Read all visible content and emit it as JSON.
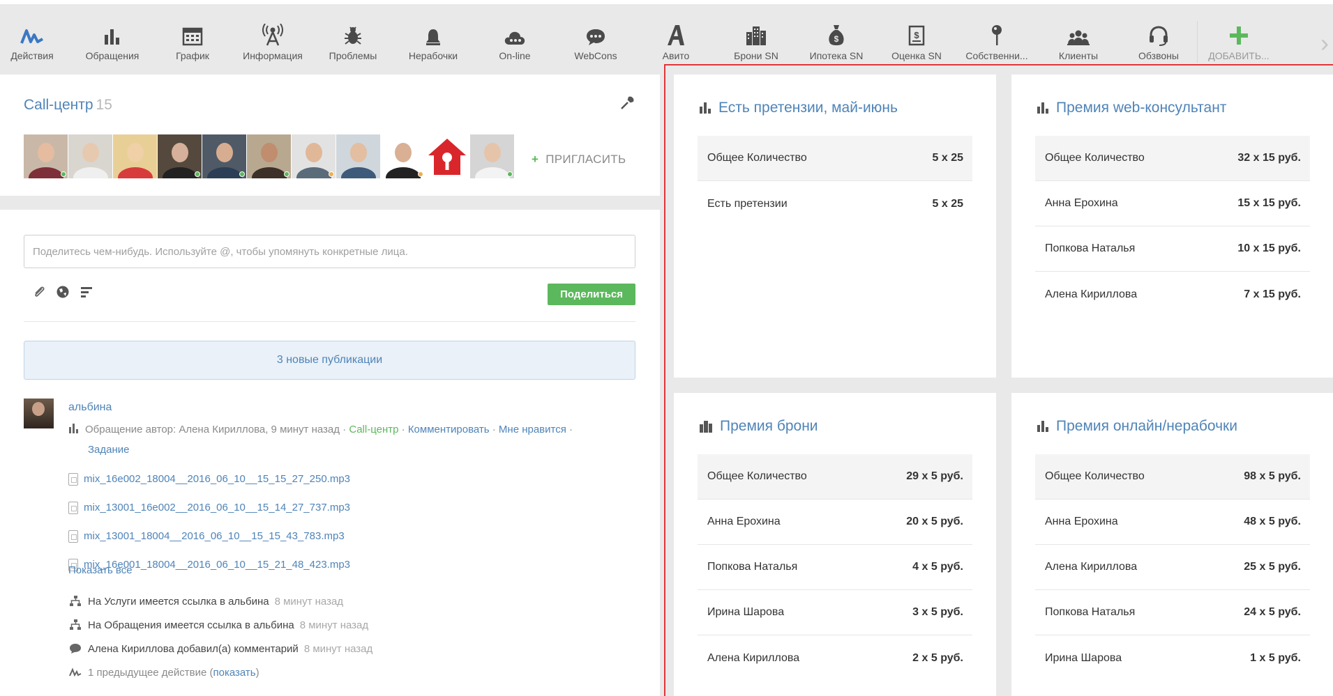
{
  "toolbar": {
    "items": [
      {
        "label": "Действия",
        "icon": "activity-icon"
      },
      {
        "label": "Обращения",
        "icon": "bar-chart-icon"
      },
      {
        "label": "График",
        "icon": "calendar-icon"
      },
      {
        "label": "Информация",
        "icon": "broadcast-icon"
      },
      {
        "label": "Проблемы",
        "icon": "bug-icon"
      },
      {
        "label": "Нерабочки",
        "icon": "bell-icon"
      },
      {
        "label": "On-line",
        "icon": "cloud-icon"
      },
      {
        "label": "WebCons",
        "icon": "chat-icon"
      },
      {
        "label": "Авито",
        "icon": "letter-a-icon"
      },
      {
        "label": "Брони SN",
        "icon": "buildings-icon"
      },
      {
        "label": "Ипотека SN",
        "icon": "money-bag-icon"
      },
      {
        "label": "Оценка SN",
        "icon": "document-dollar-icon"
      },
      {
        "label": "Собственни...",
        "icon": "pin-icon"
      },
      {
        "label": "Клиенты",
        "icon": "group-icon"
      },
      {
        "label": "Обзвоны",
        "icon": "headset-icon"
      },
      {
        "label": "ДОБАВИТЬ...",
        "icon": "plus-icon"
      }
    ]
  },
  "team": {
    "title": "Call-центр",
    "count": "15",
    "invite_label": "ПРИГЛАСИТЬ"
  },
  "feed": {
    "share_placeholder": "Поделитесь чем-нибудь. Используйте @, чтобы упомянуть конкретные лица.",
    "share_button": "Поделиться",
    "new_publications": "3 новые публикации",
    "post": {
      "author": "альбина",
      "meta_prefix": "Обращение автор: Алена Кириллова, 9 минут назад ·",
      "group": "Call-центр",
      "comment": "Комментировать",
      "like": "Мне нравится",
      "task": "Задание",
      "files": [
        "mix_16e002_18004__2016_06_10__15_15_27_250.mp3",
        "mix_13001_16e002__2016_06_10__15_14_27_737.mp3",
        "mix_13001_18004__2016_06_10__15_15_43_783.mp3",
        "mix_16e001_18004__2016_06_10__15_21_48_423.mp3"
      ],
      "show_all": "Показать все"
    },
    "activity": [
      {
        "text": "На Услуги имеется ссылка в альбина",
        "ago": "8 минут назад"
      },
      {
        "text": "На Обращения имеется ссылка в альбина",
        "ago": "8 минут назад"
      },
      {
        "text": "Алена Кириллова добавил(а) комментарий",
        "ago": "8 минут назад"
      }
    ],
    "previous": {
      "text": "1 предыдущее действие (",
      "link": "показать",
      "close": ")"
    }
  },
  "cards": [
    {
      "title": "Есть претензии, май-июнь",
      "rows": [
        {
          "name": "Общее Количество",
          "value": "5 x 25"
        },
        {
          "name": "Есть претензии",
          "value": "5 x 25"
        }
      ]
    },
    {
      "title": "Премия web-консультант",
      "rows": [
        {
          "name": "Общее Количество",
          "value": "32 x 15 руб."
        },
        {
          "name": "Анна Ерохина",
          "value": "15 x 15 руб."
        },
        {
          "name": "Попкова Наталья",
          "value": "10 x 15 руб."
        },
        {
          "name": "Алена Кириллова",
          "value": "7 x 15 руб."
        }
      ]
    },
    {
      "title": "Премия брони",
      "rows": [
        {
          "name": "Общее Количество",
          "value": "29 x 5 руб."
        },
        {
          "name": "Анна Ерохина",
          "value": "20 x 5 руб."
        },
        {
          "name": "Попкова Наталья",
          "value": "4 x 5 руб."
        },
        {
          "name": "Ирина Шарова",
          "value": "3 x 5 руб."
        },
        {
          "name": "Алена Кириллова",
          "value": "2 x 5 руб."
        }
      ]
    },
    {
      "title": "Премия онлайн/нерабочки",
      "rows": [
        {
          "name": "Общее Количество",
          "value": "98 x 5 руб."
        },
        {
          "name": "Анна Ерохина",
          "value": "48 x 5 руб."
        },
        {
          "name": "Алена Кириллова",
          "value": "25 x 5 руб."
        },
        {
          "name": "Попкова Наталья",
          "value": "24 x 5 руб."
        },
        {
          "name": "Ирина Шарова",
          "value": "1 x 5 руб."
        }
      ]
    }
  ],
  "colors": {
    "accent": "#4f84b8",
    "success": "#5cb85c",
    "highlight_frame": "#e0353a"
  }
}
